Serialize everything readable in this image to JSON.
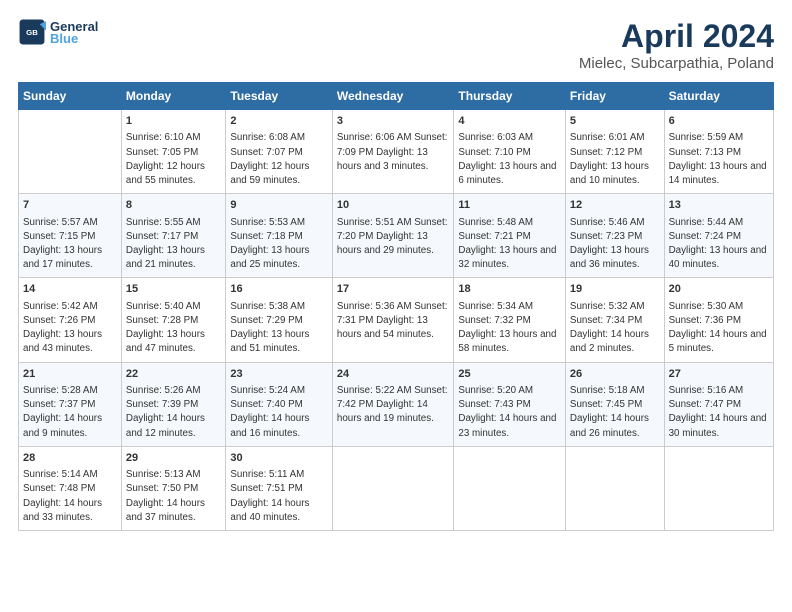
{
  "header": {
    "logo_line1": "General",
    "logo_line2": "Blue",
    "title": "April 2024",
    "subtitle": "Mielec, Subcarpathia, Poland"
  },
  "weekdays": [
    "Sunday",
    "Monday",
    "Tuesday",
    "Wednesday",
    "Thursday",
    "Friday",
    "Saturday"
  ],
  "weeks": [
    [
      {
        "day": "",
        "content": ""
      },
      {
        "day": "1",
        "content": "Sunrise: 6:10 AM\nSunset: 7:05 PM\nDaylight: 12 hours\nand 55 minutes."
      },
      {
        "day": "2",
        "content": "Sunrise: 6:08 AM\nSunset: 7:07 PM\nDaylight: 12 hours\nand 59 minutes."
      },
      {
        "day": "3",
        "content": "Sunrise: 6:06 AM\nSunset: 7:09 PM\nDaylight: 13 hours\nand 3 minutes."
      },
      {
        "day": "4",
        "content": "Sunrise: 6:03 AM\nSunset: 7:10 PM\nDaylight: 13 hours\nand 6 minutes."
      },
      {
        "day": "5",
        "content": "Sunrise: 6:01 AM\nSunset: 7:12 PM\nDaylight: 13 hours\nand 10 minutes."
      },
      {
        "day": "6",
        "content": "Sunrise: 5:59 AM\nSunset: 7:13 PM\nDaylight: 13 hours\nand 14 minutes."
      }
    ],
    [
      {
        "day": "7",
        "content": "Sunrise: 5:57 AM\nSunset: 7:15 PM\nDaylight: 13 hours\nand 17 minutes."
      },
      {
        "day": "8",
        "content": "Sunrise: 5:55 AM\nSunset: 7:17 PM\nDaylight: 13 hours\nand 21 minutes."
      },
      {
        "day": "9",
        "content": "Sunrise: 5:53 AM\nSunset: 7:18 PM\nDaylight: 13 hours\nand 25 minutes."
      },
      {
        "day": "10",
        "content": "Sunrise: 5:51 AM\nSunset: 7:20 PM\nDaylight: 13 hours\nand 29 minutes."
      },
      {
        "day": "11",
        "content": "Sunrise: 5:48 AM\nSunset: 7:21 PM\nDaylight: 13 hours\nand 32 minutes."
      },
      {
        "day": "12",
        "content": "Sunrise: 5:46 AM\nSunset: 7:23 PM\nDaylight: 13 hours\nand 36 minutes."
      },
      {
        "day": "13",
        "content": "Sunrise: 5:44 AM\nSunset: 7:24 PM\nDaylight: 13 hours\nand 40 minutes."
      }
    ],
    [
      {
        "day": "14",
        "content": "Sunrise: 5:42 AM\nSunset: 7:26 PM\nDaylight: 13 hours\nand 43 minutes."
      },
      {
        "day": "15",
        "content": "Sunrise: 5:40 AM\nSunset: 7:28 PM\nDaylight: 13 hours\nand 47 minutes."
      },
      {
        "day": "16",
        "content": "Sunrise: 5:38 AM\nSunset: 7:29 PM\nDaylight: 13 hours\nand 51 minutes."
      },
      {
        "day": "17",
        "content": "Sunrise: 5:36 AM\nSunset: 7:31 PM\nDaylight: 13 hours\nand 54 minutes."
      },
      {
        "day": "18",
        "content": "Sunrise: 5:34 AM\nSunset: 7:32 PM\nDaylight: 13 hours\nand 58 minutes."
      },
      {
        "day": "19",
        "content": "Sunrise: 5:32 AM\nSunset: 7:34 PM\nDaylight: 14 hours\nand 2 minutes."
      },
      {
        "day": "20",
        "content": "Sunrise: 5:30 AM\nSunset: 7:36 PM\nDaylight: 14 hours\nand 5 minutes."
      }
    ],
    [
      {
        "day": "21",
        "content": "Sunrise: 5:28 AM\nSunset: 7:37 PM\nDaylight: 14 hours\nand 9 minutes."
      },
      {
        "day": "22",
        "content": "Sunrise: 5:26 AM\nSunset: 7:39 PM\nDaylight: 14 hours\nand 12 minutes."
      },
      {
        "day": "23",
        "content": "Sunrise: 5:24 AM\nSunset: 7:40 PM\nDaylight: 14 hours\nand 16 minutes."
      },
      {
        "day": "24",
        "content": "Sunrise: 5:22 AM\nSunset: 7:42 PM\nDaylight: 14 hours\nand 19 minutes."
      },
      {
        "day": "25",
        "content": "Sunrise: 5:20 AM\nSunset: 7:43 PM\nDaylight: 14 hours\nand 23 minutes."
      },
      {
        "day": "26",
        "content": "Sunrise: 5:18 AM\nSunset: 7:45 PM\nDaylight: 14 hours\nand 26 minutes."
      },
      {
        "day": "27",
        "content": "Sunrise: 5:16 AM\nSunset: 7:47 PM\nDaylight: 14 hours\nand 30 minutes."
      }
    ],
    [
      {
        "day": "28",
        "content": "Sunrise: 5:14 AM\nSunset: 7:48 PM\nDaylight: 14 hours\nand 33 minutes."
      },
      {
        "day": "29",
        "content": "Sunrise: 5:13 AM\nSunset: 7:50 PM\nDaylight: 14 hours\nand 37 minutes."
      },
      {
        "day": "30",
        "content": "Sunrise: 5:11 AM\nSunset: 7:51 PM\nDaylight: 14 hours\nand 40 minutes."
      },
      {
        "day": "",
        "content": ""
      },
      {
        "day": "",
        "content": ""
      },
      {
        "day": "",
        "content": ""
      },
      {
        "day": "",
        "content": ""
      }
    ]
  ]
}
